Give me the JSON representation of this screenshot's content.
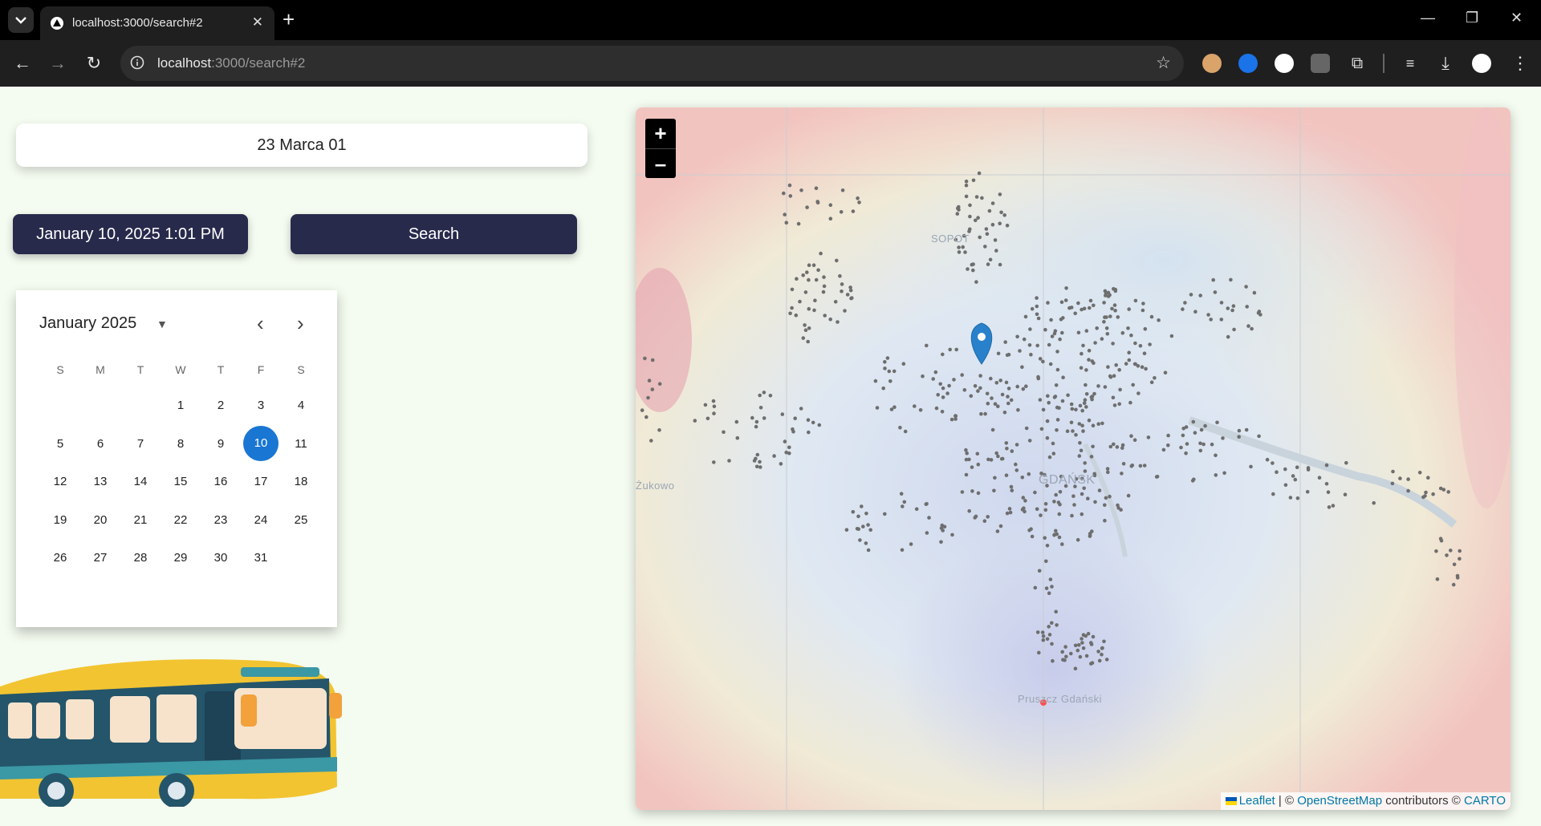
{
  "browser": {
    "tab_title": "localhost:3000/search#2",
    "url_host": "localhost",
    "url_rest": ":3000/search#2",
    "icons": {
      "tab_menu": "chevron-down-icon",
      "close_tab": "close-icon",
      "new_tab": "plus-icon",
      "back": "arrow-left-icon",
      "forward": "arrow-right-icon",
      "reload": "reload-icon",
      "site_info": "info-icon",
      "bookmark": "star-icon",
      "extensions": "puzzle-icon",
      "media": "media-queue-icon",
      "downloads": "download-icon",
      "menu": "kebab-menu-icon"
    }
  },
  "form": {
    "stop_value": "23 Marca 01",
    "date_label": "January 10, 2025 1:01 PM",
    "search_label": "Search"
  },
  "calendar": {
    "month_label": "January 2025",
    "weekdays": [
      "S",
      "M",
      "T",
      "W",
      "T",
      "F",
      "S"
    ],
    "weeks": [
      [
        "",
        "",
        "",
        "1",
        "2",
        "3",
        "4"
      ],
      [
        "5",
        "6",
        "7",
        "8",
        "9",
        "10",
        "11"
      ],
      [
        "12",
        "13",
        "14",
        "15",
        "16",
        "17",
        "18"
      ],
      [
        "19",
        "20",
        "21",
        "22",
        "23",
        "24",
        "25"
      ],
      [
        "26",
        "27",
        "28",
        "29",
        "30",
        "31",
        ""
      ]
    ],
    "selected_day": "10",
    "accent": "#1976d2"
  },
  "map": {
    "zoom_in": "+",
    "zoom_out": "–",
    "labels": {
      "sopot": "SOPOT",
      "zukowo": "Żukowo",
      "gdansk": "GDAŃSK",
      "pruszcz": "Pruszcz Gdański"
    },
    "attribution": {
      "leaflet": "Leaflet",
      "sep": " | © ",
      "osm": "OpenStreetMap",
      "contributors": " contributors © ",
      "carto": "CARTO"
    },
    "colors": {
      "marker": "#2a81cb",
      "stop_dots": "#6e6e6e",
      "button": "#282a4c"
    }
  }
}
